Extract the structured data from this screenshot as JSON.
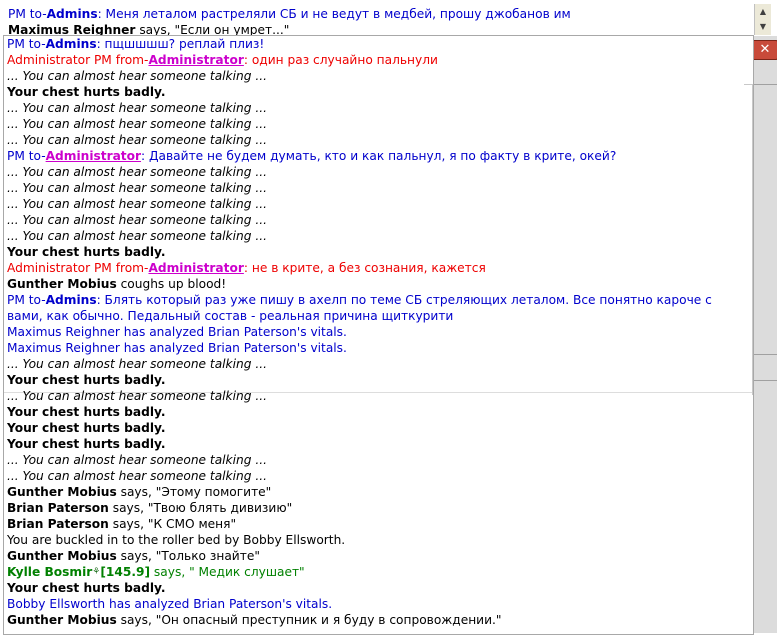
{
  "background": {
    "line1": {
      "prefix": "PM to-",
      "target": "Admins",
      "text": ": Меня леталом растреляли СБ и не ведут в медбей, прошу джобанов им"
    },
    "line2": {
      "speaker": "Maximus Reighner",
      "verb": " says, ",
      "text": "\"Если он умрет...\""
    }
  },
  "close_glyph": "✕",
  "scroll_up": "▲",
  "scroll_down": "▼",
  "messages": [
    {
      "kind": "pm-to",
      "prefix": "PM to-",
      "target": "Admins",
      "text": ": пщшшшш? реплай плиз!"
    },
    {
      "kind": "adm-from",
      "prefix": "Administrator PM from-",
      "target": "Administrator",
      "text": ": один раз случайно пальнули"
    },
    {
      "kind": "whisper",
      "text": "... You can almost hear someone talking ..."
    },
    {
      "kind": "pain",
      "text": "Your chest hurts badly."
    },
    {
      "kind": "whisper",
      "text": "... You can almost hear someone talking ..."
    },
    {
      "kind": "whisper",
      "text": "... You can almost hear someone talking ..."
    },
    {
      "kind": "whisper",
      "text": "... You can almost hear someone talking ..."
    },
    {
      "kind": "pm-to-admin",
      "prefix": " PM to-",
      "target": "Administrator",
      "text": ": Давайте не будем думать, кто и как пальнул, я по факту в крите, окей?"
    },
    {
      "kind": "whisper",
      "text": "... You can almost hear someone talking ..."
    },
    {
      "kind": "whisper",
      "text": "... You can almost hear someone talking ..."
    },
    {
      "kind": "whisper",
      "text": "... You can almost hear someone talking ..."
    },
    {
      "kind": "whisper",
      "text": "... You can almost hear someone talking ..."
    },
    {
      "kind": "whisper",
      "text": "... You can almost hear someone talking ..."
    },
    {
      "kind": "pain",
      "text": "Your chest hurts badly."
    },
    {
      "kind": "adm-from",
      "prefix": "Administrator PM from-",
      "target": "Administrator",
      "text": ": не в крите, а без сознания, кажется"
    },
    {
      "kind": "say",
      "speaker": "Gunther Mobius",
      "text": " coughs up blood!"
    },
    {
      "kind": "pm-to-wrap",
      "prefix": "PM to-",
      "target": "Admins",
      "text": ": Блять который раз уже пишу в ахелп по теме СБ стреляющих леталом. Все понятно кароче с вами, как обычно. Педальный состав - реальная причина щиткурити"
    },
    {
      "kind": "notice",
      "text": " Maximus Reighner has analyzed Brian Paterson's vitals."
    },
    {
      "kind": "notice",
      "text": " Maximus Reighner has analyzed Brian Paterson's vitals."
    },
    {
      "kind": "whisper",
      "text": "... You can almost hear someone talking ..."
    },
    {
      "kind": "pain",
      "text": "Your chest hurts badly."
    },
    {
      "kind": "whisper",
      "text": "... You can almost hear someone talking ..."
    },
    {
      "kind": "pain",
      "text": "Your chest hurts badly."
    },
    {
      "kind": "pain",
      "text": "Your chest hurts badly."
    },
    {
      "kind": "pain",
      "text": "Your chest hurts badly."
    },
    {
      "kind": "whisper",
      "text": "... You can almost hear someone talking ..."
    },
    {
      "kind": "whisper",
      "text": "... You can almost hear someone talking ..."
    },
    {
      "kind": "say",
      "speaker": "Gunther Mobius",
      "text": " says, \"Этому помогите\""
    },
    {
      "kind": "say",
      "speaker": "Brian Paterson",
      "text": " says, \"Твою блять дивизию\""
    },
    {
      "kind": "say",
      "speaker": "Brian Paterson",
      "text": " says, \"К СМО меня\""
    },
    {
      "kind": "plain",
      "text": "You are buckled in to the roller bed by Bobby Ellsworth."
    },
    {
      "kind": "say",
      "speaker": "Gunther Mobius",
      "text": " says, \"Только знайте\""
    },
    {
      "kind": "radio",
      "speaker": "Kylle Bosmir",
      "freq": "[145.9]",
      "text": " says, \" Медик слушает\""
    },
    {
      "kind": "pain",
      "text": "Your chest hurts badly."
    },
    {
      "kind": "notice",
      "text": " Bobby Ellsworth has analyzed Brian Paterson's vitals."
    },
    {
      "kind": "say",
      "speaker": "Gunther Mobius",
      "text": " says, \"Он опасный преступник и я буду в сопровождении.\""
    }
  ]
}
